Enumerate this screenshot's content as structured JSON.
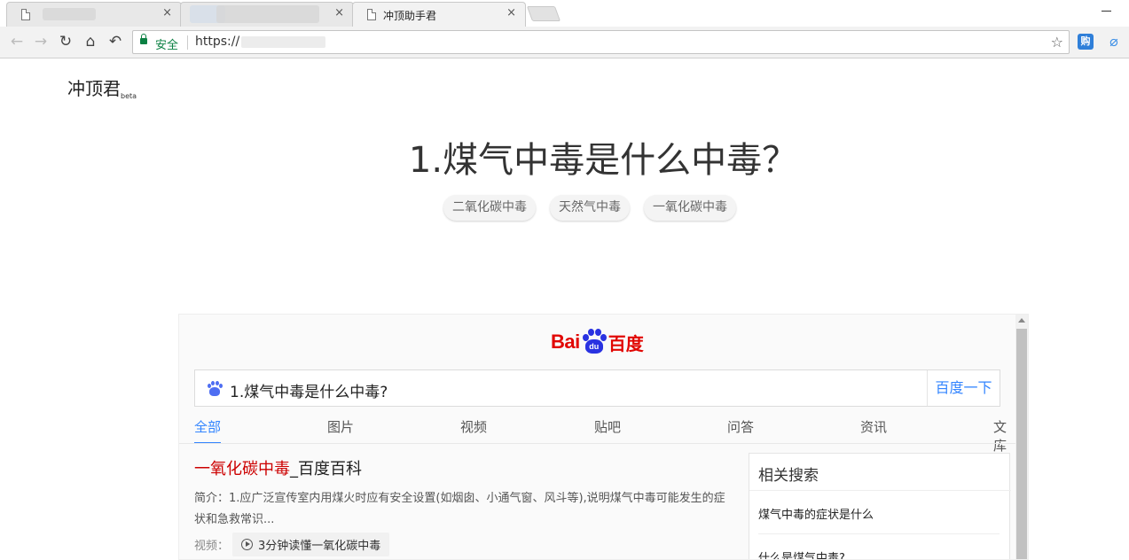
{
  "browser": {
    "tabs": [
      {
        "title": ""
      },
      {
        "title": ""
      },
      {
        "title": "冲顶助手君"
      }
    ],
    "close_glyph": "×",
    "address": {
      "secure_label": "安全",
      "url": "https://"
    },
    "ext_label": "购"
  },
  "site": {
    "logo": "冲顶君",
    "logo_sup": "beta",
    "question": "1.煤气中毒是什么中毒？",
    "options": [
      "二氧化碳中毒",
      "天然气中毒",
      "一氧化碳中毒"
    ]
  },
  "baidu": {
    "logo_bai": "Bai",
    "logo_du": "du",
    "logo_cn": "百度",
    "query": "1.煤气中毒是什么中毒?",
    "search_button": "百度一下",
    "tabs": [
      "全部",
      "图片",
      "视频",
      "贴吧",
      "问答",
      "资讯",
      "文库"
    ],
    "result": {
      "title_highlight": "一氧化碳中毒",
      "title_rest": "_百度百科",
      "desc": "简介：1.应广泛宣传室内用煤火时应有安全设置(如烟囱、小通气窗、风斗等),说明煤气中毒可能发生的症状和急救常识...",
      "video_label": "视频：",
      "video_title": "3分钟读懂一氧化碳中毒"
    },
    "related": {
      "title": "相关搜索",
      "items": [
        "煤气中毒的症状是什么",
        "什么是煤气中毒?"
      ]
    }
  }
}
